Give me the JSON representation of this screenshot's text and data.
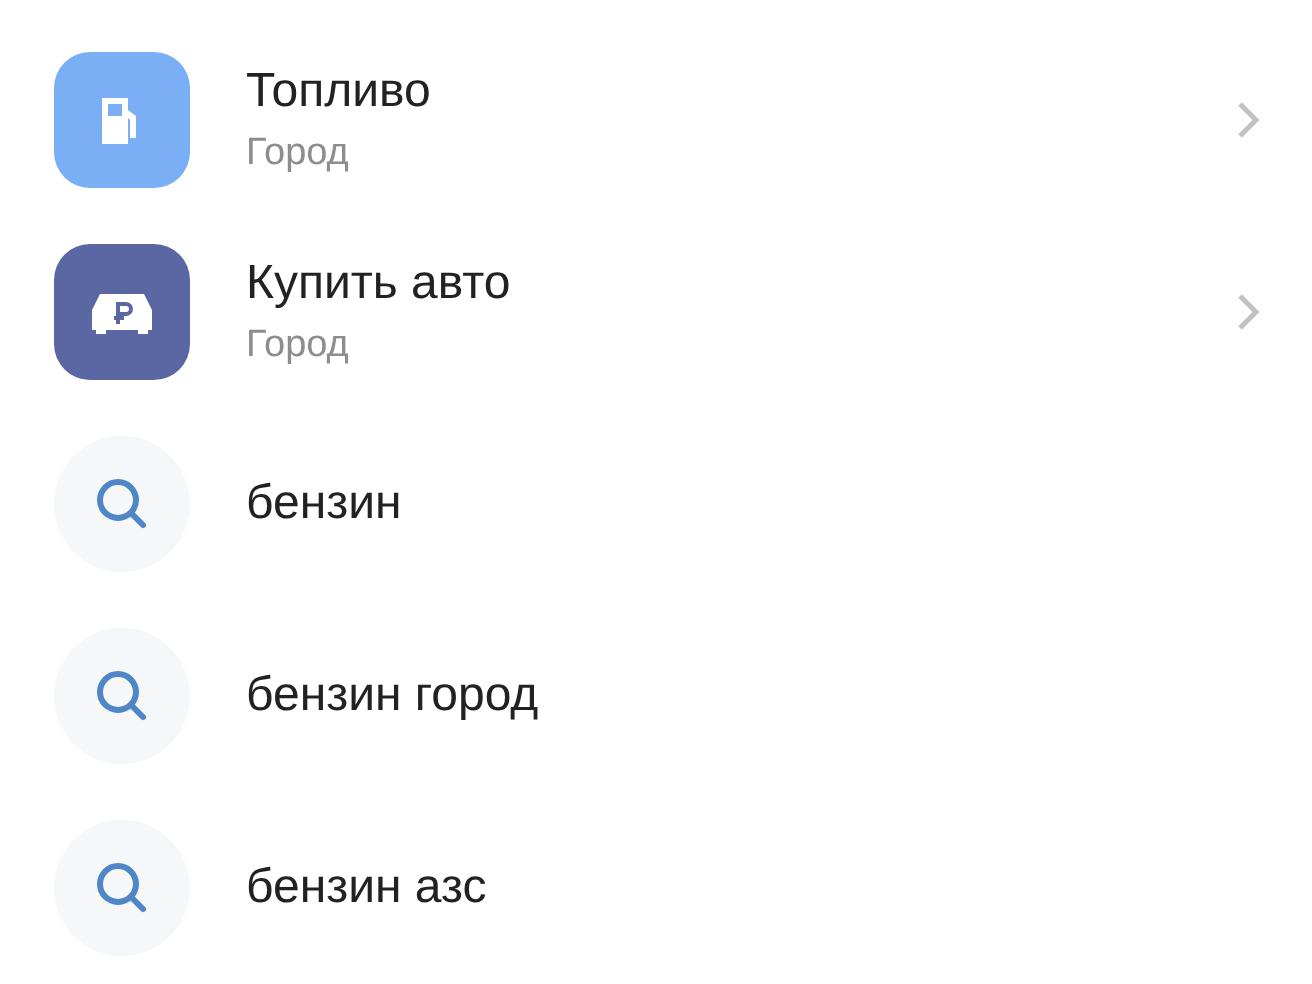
{
  "results": [
    {
      "kind": "fuel",
      "color": "#7aaef5",
      "title": "Топливо",
      "subtitle": "Город"
    },
    {
      "kind": "car",
      "color": "#5b67a3",
      "title": "Купить авто",
      "subtitle": "Город"
    },
    {
      "kind": "search",
      "title": "бензин"
    },
    {
      "kind": "search",
      "title": "бензин город"
    },
    {
      "kind": "search",
      "title": "бензин азс"
    }
  ]
}
